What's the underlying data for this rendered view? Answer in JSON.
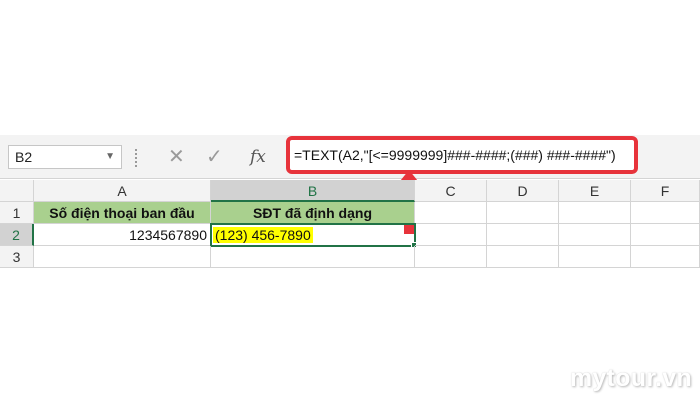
{
  "formula_bar": {
    "name_box": "B2",
    "name_box_icon": "chevron-down-icon",
    "cancel_icon": "close-icon",
    "enter_icon": "check-icon",
    "fx_label": "fx",
    "formula": "=TEXT(A2,\"[<=9999999]###-####;(###) ###-####\")"
  },
  "annotation": {
    "arrow_color": "#e7333b",
    "box_color": "#e7333b"
  },
  "sheet": {
    "columns": [
      "A",
      "B",
      "C",
      "D",
      "E",
      "F"
    ],
    "rows": [
      "1",
      "2",
      "3"
    ],
    "header_fill": "#a9d08e",
    "highlight": "#ffff00",
    "A1": "Số điện thoại ban đầu",
    "B1": "SĐT đã định dạng",
    "A2": "1234567890",
    "B2": "(123) 456-7890",
    "selected_cell": "B2"
  },
  "watermark": "mytour.vn"
}
